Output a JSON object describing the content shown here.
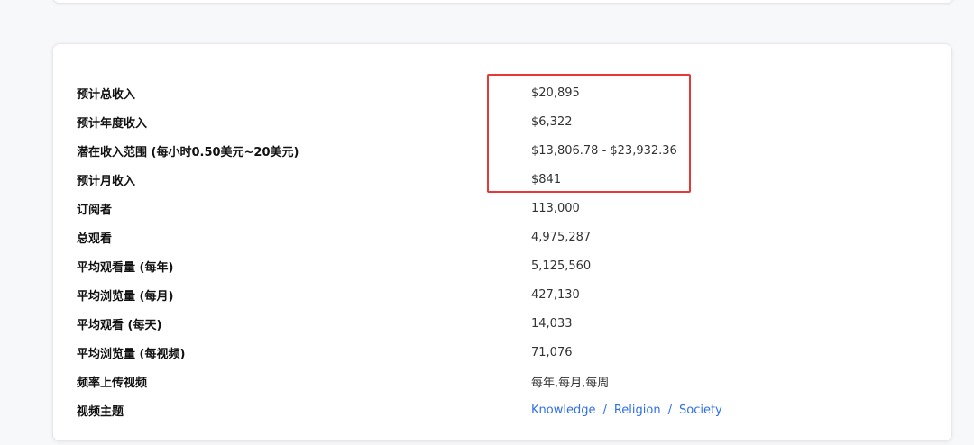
{
  "stats": [
    {
      "label": "预计总收入",
      "value": "$20,895"
    },
    {
      "label": "预计年度收入",
      "value": "$6,322"
    },
    {
      "label": "潜在收入范围 (每小时0.50美元~20美元)",
      "value": "$13,806.78 - $23,932.36"
    },
    {
      "label": "预计月收入",
      "value": "$841"
    },
    {
      "label": "订阅者",
      "value": "113,000"
    },
    {
      "label": "总观看",
      "value": "4,975,287"
    },
    {
      "label": "平均观看量 (每年)",
      "value": "5,125,560"
    },
    {
      "label": "平均浏览量 (每月)",
      "value": "427,130"
    },
    {
      "label": "平均观看 (每天)",
      "value": "14,033"
    },
    {
      "label": "平均浏览量 (每视频)",
      "value": "71,076"
    },
    {
      "label": "频率上传视频",
      "value": "每年,每月,每周"
    }
  ],
  "topics": {
    "label": "视频主题",
    "items": [
      "Knowledge",
      "Religion",
      "Society"
    ],
    "separator": "/"
  },
  "colors": {
    "highlight": "#e53935",
    "link": "#2f6fe6"
  }
}
